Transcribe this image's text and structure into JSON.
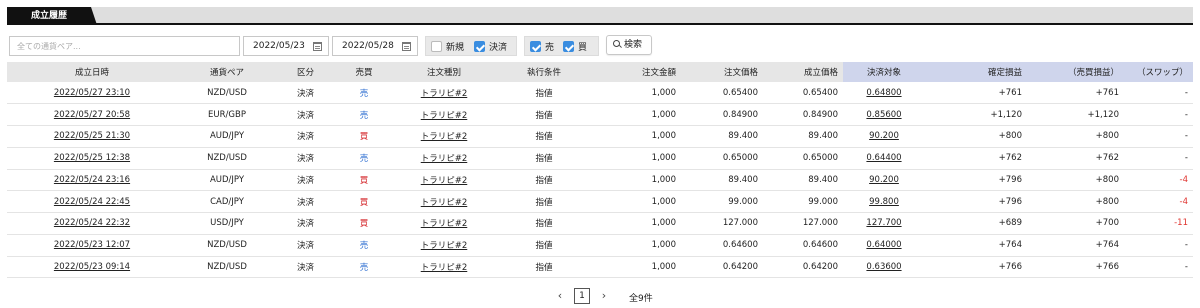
{
  "tab": {
    "label": "成立履歴"
  },
  "filters": {
    "search_placeholder": "全ての通貨ペア...",
    "date_from": "2022/05/23",
    "date_to": "2022/05/28",
    "chk_new": {
      "label": "新規",
      "checked": false
    },
    "chk_settle": {
      "label": "決済",
      "checked": true
    },
    "chk_sell": {
      "label": "売",
      "checked": true
    },
    "chk_buy": {
      "label": "買",
      "checked": true
    },
    "search_button": "検索"
  },
  "table": {
    "headers": [
      "成立日時",
      "通貨ペア",
      "区分",
      "売買",
      "注文種別",
      "執行条件",
      "注文金額",
      "注文価格",
      "成立価格",
      "決済対象",
      "確定損益",
      "（売買損益）",
      "（スワップ）"
    ],
    "rows": [
      [
        "2022/05/27 23:10",
        "NZD/USD",
        "決済",
        "売",
        "トラリピ#2",
        "指値",
        "1,000",
        "0.65400",
        "0.65400",
        "0.64800",
        "+761",
        "+761",
        "-"
      ],
      [
        "2022/05/27 20:58",
        "EUR/GBP",
        "決済",
        "売",
        "トラリピ#2",
        "指値",
        "1,000",
        "0.84900",
        "0.84900",
        "0.85600",
        "+1,120",
        "+1,120",
        "-"
      ],
      [
        "2022/05/25 21:30",
        "AUD/JPY",
        "決済",
        "買",
        "トラリピ#2",
        "指値",
        "1,000",
        "89.400",
        "89.400",
        "90.200",
        "+800",
        "+800",
        "-"
      ],
      [
        "2022/05/25 12:38",
        "NZD/USD",
        "決済",
        "売",
        "トラリピ#2",
        "指値",
        "1,000",
        "0.65000",
        "0.65000",
        "0.64400",
        "+762",
        "+762",
        "-"
      ],
      [
        "2022/05/24 23:16",
        "AUD/JPY",
        "決済",
        "買",
        "トラリピ#2",
        "指値",
        "1,000",
        "89.400",
        "89.400",
        "90.200",
        "+796",
        "+800",
        "-4"
      ],
      [
        "2022/05/24 22:45",
        "CAD/JPY",
        "決済",
        "買",
        "トラリピ#2",
        "指値",
        "1,000",
        "99.000",
        "99.000",
        "99.800",
        "+796",
        "+800",
        "-4"
      ],
      [
        "2022/05/24 22:32",
        "USD/JPY",
        "決済",
        "買",
        "トラリピ#2",
        "指値",
        "1,000",
        "127.000",
        "127.000",
        "127.700",
        "+689",
        "+700",
        "-11"
      ],
      [
        "2022/05/23 12:07",
        "NZD/USD",
        "決済",
        "売",
        "トラリピ#2",
        "指値",
        "1,000",
        "0.64600",
        "0.64600",
        "0.64000",
        "+764",
        "+764",
        "-"
      ],
      [
        "2022/05/23 09:14",
        "NZD/USD",
        "決済",
        "売",
        "トラリピ#2",
        "指値",
        "1,000",
        "0.64200",
        "0.64200",
        "0.63600",
        "+766",
        "+766",
        "-"
      ]
    ]
  },
  "pagination": {
    "prev": "‹",
    "current": "1",
    "next": "›",
    "total": "全9件"
  },
  "colors": {
    "sell": "#2f6fd1",
    "buy": "#d4262a",
    "negative": "#e0342f",
    "checkbox_on": "#3a8de0",
    "highlight_header": "#cfd5ec"
  },
  "icons": {
    "calendar": "calendar-icon",
    "search": "magnifier-icon",
    "check": "check-icon"
  }
}
